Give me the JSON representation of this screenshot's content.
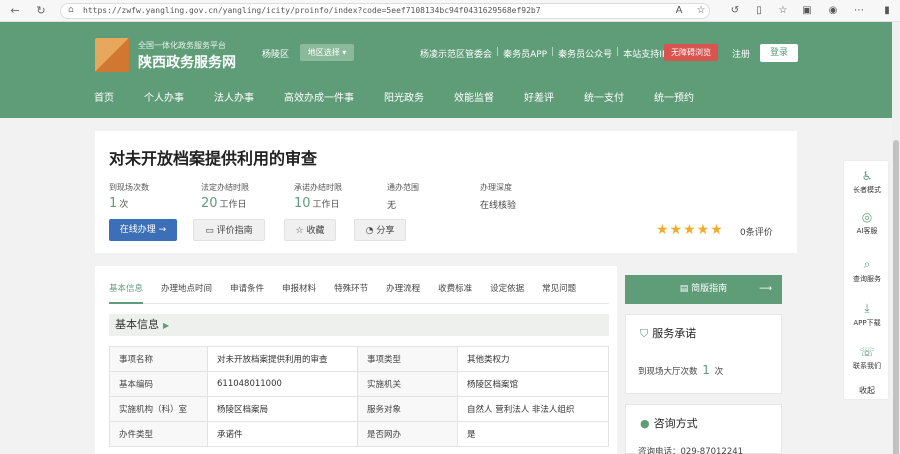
{
  "browser": {
    "url": "https://zwfw.yangling.gov.cn/yangling/icity/proinfo/index?code=5eef7108134bc94f0431629568ef92b7",
    "back_icon": "back-arrow-icon",
    "reload_icon": "reload-icon"
  },
  "header": {
    "platform_label": "全国一体化政务服务平台",
    "brand_name": "陕西政务服务网",
    "region": "杨陵区",
    "region_select": "地区选择 ▾",
    "links": [
      "杨凌示范区管委会",
      "秦务员APP",
      "秦务员公众号",
      "本站支持IPv6"
    ],
    "barrier_free": "无障碍浏览",
    "register": "注册",
    "login": "登录",
    "nav": [
      "首页",
      "个人办事",
      "法人办事",
      "高效办成一件事",
      "阳光政务",
      "效能监督",
      "好差评",
      "统一支付",
      "统一预约"
    ]
  },
  "service": {
    "title": "对未开放档案提供利用的审查",
    "metrics": [
      {
        "label": "到现场次数",
        "value": "1",
        "unit": "次"
      },
      {
        "label": "法定办结时限",
        "value": "20",
        "unit": "工作日"
      },
      {
        "label": "承诺办结时限",
        "value": "10",
        "unit": "工作日"
      },
      {
        "label": "通办范围",
        "text": "无"
      },
      {
        "label": "办理深度",
        "text": "在线核验"
      }
    ],
    "online_btn": "在线办理 →",
    "guide_btn": "评价指南",
    "collect_btn": "收藏",
    "share_btn": "分享",
    "stars": "★★★★★",
    "rating": 5,
    "rating_text": "0条评价"
  },
  "tabs": [
    "基本信息",
    "办理地点时间",
    "申请条件",
    "申报材料",
    "特殊环节",
    "办理流程",
    "收费标准",
    "设定依据",
    "常见问题"
  ],
  "basic": {
    "heading": "基本信息",
    "rows": [
      [
        "事项名称",
        "对未开放档案提供利用的审查",
        "事项类型",
        "其他类权力"
      ],
      [
        "基本编码",
        "611048011000",
        "实施机关",
        "杨陵区档案馆"
      ],
      [
        "实施机构（科）室",
        "杨陵区档案局",
        "服务对象",
        "自然人 营利法人 非法人组织"
      ],
      [
        "办件类型",
        "承诺件",
        "是否网办",
        "是"
      ]
    ]
  },
  "side": {
    "guide": "简版指南",
    "promise_title": "服务承诺",
    "promise_label": "到现场大厅次数",
    "promise_value": "1",
    "promise_unit": "次",
    "consult_title": "咨询方式",
    "consult_phone": "咨询电话：029-87012241"
  },
  "float_menu": [
    {
      "icon": "elder-mode-icon",
      "glyph": "♿",
      "label": "长者模式"
    },
    {
      "icon": "ai-service-icon",
      "glyph": "◎",
      "label": "AI客服"
    },
    {
      "icon": "search-service-icon",
      "glyph": "⌕",
      "label": "查询服务"
    },
    {
      "icon": "app-download-icon",
      "glyph": "⤓",
      "label": "APP下载"
    },
    {
      "icon": "contact-us-icon",
      "glyph": "☏",
      "label": "联系我们"
    },
    {
      "icon": "collapse-icon",
      "glyph": "",
      "label": "收起"
    }
  ]
}
